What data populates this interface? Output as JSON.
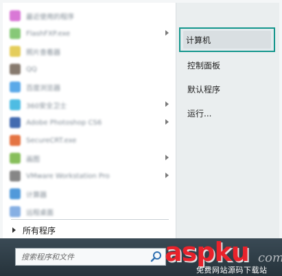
{
  "start_menu": {
    "programs": [
      {
        "label": "最近使用的程序",
        "icon_color": "#d56ad2",
        "arrow": false
      },
      {
        "label": "FlashFXP.exe",
        "icon_color": "#7ac36a",
        "arrow": true
      },
      {
        "label": "照片查看器",
        "icon_color": "#e2c84a",
        "arrow": false
      },
      {
        "label": "QQ",
        "icon_color": "#7a6c5f",
        "arrow": false
      },
      {
        "label": "百度浏览器",
        "icon_color": "#4aa0e6",
        "arrow": false
      },
      {
        "label": "360安全卫士",
        "icon_color": "#3bb5e0",
        "arrow": true
      },
      {
        "label": "Adobe Photoshop CS6",
        "icon_color": "#2f5ba8",
        "arrow": true
      },
      {
        "label": "SecureCRT.exe",
        "icon_color": "#e2652f",
        "arrow": false
      },
      {
        "label": "画图",
        "icon_color": "#7bb84a",
        "arrow": true
      },
      {
        "label": "VMware Workstation Pro",
        "icon_color": "#7a7a7a",
        "arrow": true
      },
      {
        "label": "计算器",
        "icon_color": "#3f8fd6",
        "arrow": false
      },
      {
        "label": "远程桌面",
        "icon_color": "#7aa7e0",
        "arrow": false
      }
    ],
    "all_programs": "所有程序",
    "right_items": [
      "计算机",
      "控制面板",
      "默认程序",
      "运行..."
    ],
    "search_placeholder": "搜索程序和文件"
  },
  "watermark": {
    "brand": "aspku",
    "suffix": "com",
    "subtitle": "免费网站源码下载站"
  },
  "colors": {
    "selection_border": "#12958b",
    "watermark_red": "#e8222b"
  }
}
